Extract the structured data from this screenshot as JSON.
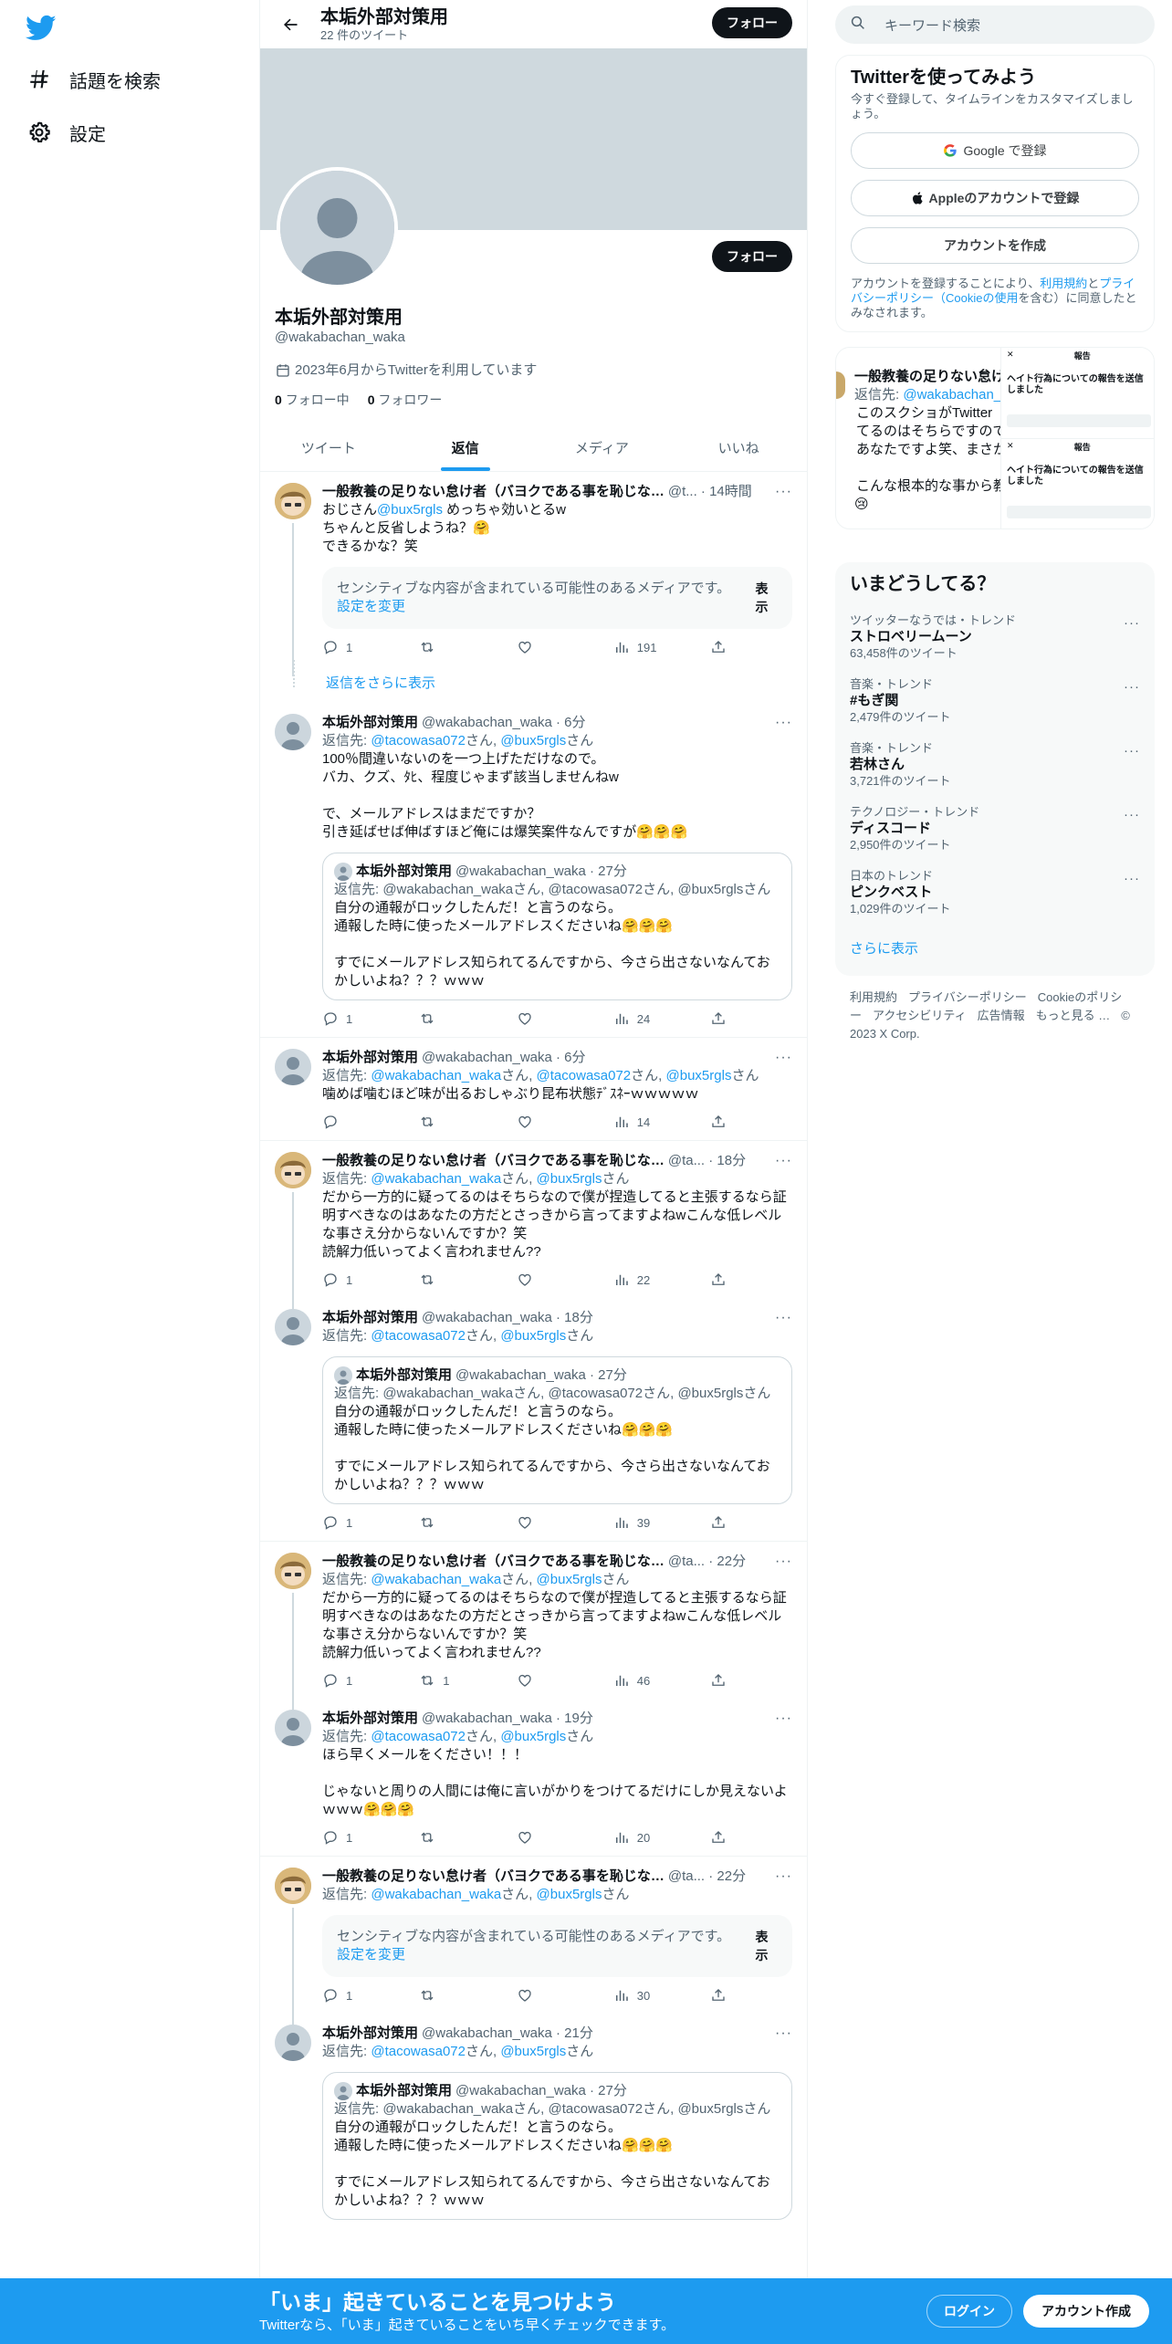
{
  "nav": {
    "explore_label": "話題を検索",
    "settings_label": "設定"
  },
  "header": {
    "title": "本垢外部対策用",
    "tweet_count": "22 件のツイート",
    "follow_label": "フォロー"
  },
  "profile": {
    "name": "本垢外部対策用",
    "handle": "@wakabachan_waka",
    "joined": "2023年6月からTwitterを利用しています",
    "following_count": "0",
    "following_label": "フォロー中",
    "followers_count": "0",
    "followers_label": "フォロワー",
    "follow_label": "フォロー"
  },
  "tabs": [
    "ツイート",
    "返信",
    "メディア",
    "いいね"
  ],
  "labels": {
    "reply_to": "返信先: ",
    "san": "さん",
    "and": ", ",
    "show": "表示",
    "sensitive": "センシティブな内容が含まれている可能性のあるメディアです。",
    "change_settings": "設定を変更",
    "show_more_replies": "返信をさらに表示"
  },
  "tweets": [
    {
      "name": "一般教養の足りない怠け者（バヨクである事を恥じな…",
      "handle": "@t...",
      "time": "14時間",
      "avatar": "anime",
      "thread": true,
      "text_parts": [
        "おじさん",
        "@bux5rgls",
        " めっちゃ効いとるw\nちゃんと反省しようね？🤗\nできるかな？笑"
      ],
      "sensitive": true,
      "stats": {
        "reply": "1",
        "retweet": "",
        "like": "",
        "views": "191"
      },
      "show_more": true
    },
    {
      "name": "本垢外部対策用",
      "handle": "@wakabachan_waka",
      "time": "6分",
      "avatar": "default",
      "thread": false,
      "reply_to": [
        "@tacowasa072",
        "@bux5rgls"
      ],
      "text": "100％間違いないのを一つ上げただけなので。\nバカ、クズ、ﾀﾋ、程度じゃまず該当しませんねw\n\nで、メールアドレスはまだですか？\n引き延ばせば伸ばすほど俺には爆笑案件なんですが🤗🤗🤗",
      "quote": {
        "name": "本垢外部対策用",
        "handle": "@wakabachan_waka",
        "time": "27分",
        "reply_to": "返信先: @wakabachan_wakaさん, @tacowasa072さん, @bux5rglsさん",
        "text": "自分の通報がロックしたんだ！と言うのなら。\n通報した時に使ったメールアドレスくださいね🤗🤗🤗\n\nすでにメールアドレス知られてるんですから、今さら出さないなんておかしいよね？？？ｗｗｗ"
      },
      "stats": {
        "reply": "1",
        "retweet": "",
        "like": "",
        "views": "24"
      },
      "sep": true
    },
    {
      "name": "本垢外部対策用",
      "handle": "@wakabachan_waka",
      "time": "6分",
      "avatar": "default",
      "thread": false,
      "reply_to": [
        "@wakabachan_waka",
        "@tacowasa072",
        "@bux5rgls"
      ],
      "text": "噛めば噛むほど味が出るおしゃぶり昆布状態ﾃﾞｽﾈｰｗｗｗｗｗ",
      "stats": {
        "reply": "",
        "retweet": "",
        "like": "",
        "views": "14"
      },
      "sep": true
    },
    {
      "name": "一般教養の足りない怠け者（バヨクである事を恥じな…",
      "handle": "@ta...",
      "time": "18分",
      "avatar": "anime",
      "thread": true,
      "reply_to": [
        "@wakabachan_waka",
        "@bux5rgls"
      ],
      "text": "だから一方的に疑ってるのはそちらなので僕が捏造してると主張するなら証明すべきなのはあなたの方だとさっきから言ってますよねwこんな低レベルな事さえ分からないんですか？笑\n読解力低いってよく言われません??",
      "stats": {
        "reply": "1",
        "retweet": "",
        "like": "",
        "views": "22"
      }
    },
    {
      "name": "本垢外部対策用",
      "handle": "@wakabachan_waka",
      "time": "18分",
      "avatar": "default",
      "thread": false,
      "reply_to": [
        "@tacowasa072",
        "@bux5rgls"
      ],
      "text": "",
      "quote": {
        "name": "本垢外部対策用",
        "handle": "@wakabachan_waka",
        "time": "27分",
        "reply_to": "返信先: @wakabachan_wakaさん, @tacowasa072さん, @bux5rglsさん",
        "text": "自分の通報がロックしたんだ！と言うのなら。\n通報した時に使ったメールアドレスくださいね🤗🤗🤗\n\nすでにメールアドレス知られてるんですから、今さら出さないなんておかしいよね？？？ｗｗｗ"
      },
      "stats": {
        "reply": "1",
        "retweet": "",
        "like": "",
        "views": "39"
      },
      "sep": true
    },
    {
      "name": "一般教養の足りない怠け者（バヨクである事を恥じな…",
      "handle": "@ta...",
      "time": "22分",
      "avatar": "anime",
      "thread": true,
      "reply_to": [
        "@wakabachan_waka",
        "@bux5rgls"
      ],
      "text": "だから一方的に疑ってるのはそちらなので僕が捏造してると主張するなら証明すべきなのはあなたの方だとさっきから言ってますよねwこんな低レベルな事さえ分からないんですか？笑\n読解力低いってよく言われません??",
      "stats": {
        "reply": "1",
        "retweet": "1",
        "like": "",
        "views": "46"
      }
    },
    {
      "name": "本垢外部対策用",
      "handle": "@wakabachan_waka",
      "time": "19分",
      "avatar": "default",
      "thread": false,
      "reply_to": [
        "@tacowasa072",
        "@bux5rgls"
      ],
      "text": "ほら早くメールをください！！！\n\nじゃないと周りの人間には俺に言いがかりをつけてるだけにしか見えないよｗｗｗ🤗🤗🤗",
      "stats": {
        "reply": "1",
        "retweet": "",
        "like": "",
        "views": "20"
      },
      "sep": true
    },
    {
      "name": "一般教養の足りない怠け者（バヨクである事を恥じな…",
      "handle": "@ta...",
      "time": "22分",
      "avatar": "anime",
      "thread": true,
      "reply_to": [
        "@wakabachan_waka",
        "@bux5rgls"
      ],
      "sensitive": true,
      "stats": {
        "reply": "1",
        "retweet": "",
        "like": "",
        "views": "30"
      }
    },
    {
      "name": "本垢外部対策用",
      "handle": "@wakabachan_waka",
      "time": "21分",
      "avatar": "default",
      "thread": false,
      "reply_to": [
        "@tacowasa072",
        "@bux5rgls"
      ],
      "text": "",
      "quote": {
        "name": "本垢外部対策用",
        "handle": "@wakabachan_waka",
        "time": "27分",
        "reply_to": "返信先: @wakabachan_wakaさん, @tacowasa072さん, @bux5rglsさん",
        "text": "自分の通報がロックしたんだ！と言うのなら。\n通報した時に使ったメールアドレスくださいね🤗🤗🤗\n\nすでにメールアドレス知られてるんですから、今さら出さないなんておかしいよね？？？ｗｗｗ"
      }
    }
  ],
  "search": {
    "placeholder": "キーワード検索"
  },
  "signup": {
    "title": "Twitterを使ってみよう",
    "desc": "今すぐ登録して、タイムラインをカスタマイズしましょう。",
    "google": "Google で登録",
    "apple": "Appleのアカウントで登録",
    "create": "アカウントを作成",
    "terms_1": "アカウントを登録することにより、",
    "terms_link1": "利用規約",
    "terms_2": "と",
    "terms_link2": "プライバシーポリシー（Cookieの使用",
    "terms_3": "を含む）に同意したとみなされます。"
  },
  "media_card": {
    "name": "一般教養の足りない怠け",
    "reply": "返信先: ",
    "reply_handle": "@wakabachan_w",
    "lines": [
      "このスクショがTwitter",
      "てるのはそちらですので",
      "あなたですよ笑、まさか",
      "",
      "こんな根本的な事から教"
    ],
    "emoji": "😢",
    "report_header": "報告",
    "report_title": "ヘイト行為についての報告を送信しました"
  },
  "trends": {
    "title": "いまどうしてる？",
    "items": [
      {
        "context": "ツイッターなうでは・トレンド",
        "name": "ストロベリームーン",
        "count": "63,458件のツイート"
      },
      {
        "context": "音楽・トレンド",
        "name": "#もぎ関",
        "count": "2,479件のツイート"
      },
      {
        "context": "音楽・トレンド",
        "name": "若林さん",
        "count": "3,721件のツイート"
      },
      {
        "context": "テクノロジー・トレンド",
        "name": "ディスコード",
        "count": "2,950件のツイート"
      },
      {
        "context": "日本のトレンド",
        "name": "ピンクベスト",
        "count": "1,029件のツイート"
      }
    ],
    "see_more": "さらに表示"
  },
  "footer": {
    "links": [
      "利用規約",
      "プライバシーポリシー",
      "Cookieのポリシー",
      "アクセシビリティ",
      "広告情報",
      "もっと見る …",
      "© 2023 X Corp."
    ]
  },
  "bottom": {
    "title": "「いま」起きていることを見つけよう",
    "sub": "Twitterなら、「いま」起きていることをいち早くチェックできます。",
    "login": "ログイン",
    "signup": "アカウント作成"
  },
  "colors": {
    "brand": "#1d9bf0",
    "text": "#0f1419",
    "muted": "#536471",
    "banner": "#cfd9de"
  }
}
